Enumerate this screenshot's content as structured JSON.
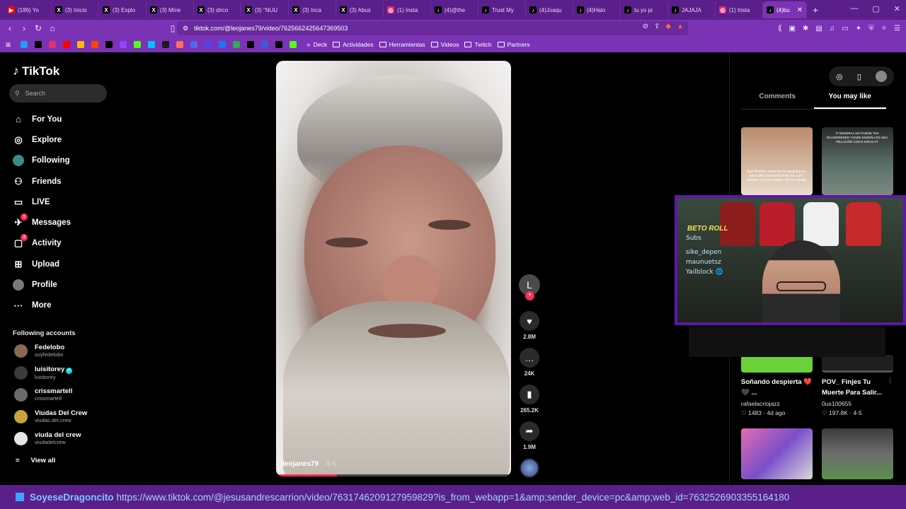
{
  "browser": {
    "tabs": [
      {
        "label": "(186) Yo",
        "icon": "youtube-icon",
        "color": "#ff0000",
        "glyph": "▶"
      },
      {
        "label": "(3) Inicio",
        "icon": "x-icon",
        "color": "#000000",
        "glyph": "X"
      },
      {
        "label": "(3) Explo",
        "icon": "x-icon",
        "color": "#000000",
        "glyph": "X"
      },
      {
        "label": "(3) Mine",
        "icon": "x-icon",
        "color": "#000000",
        "glyph": "X"
      },
      {
        "label": "(3) dirco",
        "icon": "x-icon",
        "color": "#000000",
        "glyph": "X"
      },
      {
        "label": "(3) \"NUU",
        "icon": "x-icon",
        "color": "#000000",
        "glyph": "X"
      },
      {
        "label": "(3) Inca",
        "icon": "x-icon",
        "color": "#000000",
        "glyph": "X"
      },
      {
        "label": "(3) Abus",
        "icon": "x-icon",
        "color": "#000000",
        "glyph": "X"
      },
      {
        "label": "(1) Insta",
        "icon": "instagram-icon",
        "color": "#e1306c",
        "glyph": "◎"
      },
      {
        "label": "(4)@the",
        "icon": "tiktok-icon",
        "color": "#000000",
        "glyph": "♪"
      },
      {
        "label": "Trust My",
        "icon": "tiktok-icon",
        "color": "#000000",
        "glyph": "♪"
      },
      {
        "label": "(4)Joaqu",
        "icon": "tiktok-icon",
        "color": "#000000",
        "glyph": "♪"
      },
      {
        "label": "(4)Halo",
        "icon": "tiktok-icon",
        "color": "#000000",
        "glyph": "♪"
      },
      {
        "label": "tu yo pi",
        "icon": "tiktok-icon",
        "color": "#000000",
        "glyph": "♪"
      },
      {
        "label": "JAJAJA",
        "icon": "tiktok-icon",
        "color": "#000000",
        "glyph": "♪"
      },
      {
        "label": "(1) Insta",
        "icon": "instagram-icon",
        "color": "#e1306c",
        "glyph": "◎"
      },
      {
        "label": "(4)bu",
        "icon": "tiktok-icon",
        "color": "#000000",
        "glyph": "♪",
        "active": true
      }
    ],
    "url": "tiktok.com/@leojanes79/video/7625662425647369503",
    "bookmarks": [
      {
        "label": "Deck",
        "type": "link"
      },
      {
        "label": "Actividades",
        "type": "folder"
      },
      {
        "label": "Herramientas",
        "type": "folder"
      },
      {
        "label": "Videos",
        "type": "folder"
      },
      {
        "label": "Twitch",
        "type": "folder"
      },
      {
        "label": "Partners",
        "type": "folder"
      }
    ],
    "bookmark_icon_colors": [
      "#1da1f2",
      "#000000",
      "#e1306c",
      "#ff0000",
      "#fbbc05",
      "#ff4500",
      "#000000",
      "#9146ff",
      "#53fc18",
      "#00c2ff",
      "#1c1c1c",
      "#ff6f61",
      "#5865f2",
      "#4f46e5",
      "#1877f2",
      "#34a853",
      "#000000",
      "#3b5bdb",
      "#000000",
      "#53fc18"
    ]
  },
  "tiktok": {
    "logo": "TikTok",
    "search_placeholder": "Search",
    "nav": [
      {
        "label": "For You",
        "icon": "home-icon",
        "glyph": "⌂"
      },
      {
        "label": "Explore",
        "icon": "compass-icon",
        "glyph": "◎"
      },
      {
        "label": "Following",
        "icon": "following-avatar-icon",
        "glyph": "●"
      },
      {
        "label": "Friends",
        "icon": "friends-icon",
        "glyph": "⚇"
      },
      {
        "label": "LIVE",
        "icon": "live-icon",
        "glyph": "▭"
      },
      {
        "label": "Messages",
        "icon": "messages-icon",
        "glyph": "✈",
        "badge": "1"
      },
      {
        "label": "Activity",
        "icon": "activity-icon",
        "glyph": "▢",
        "badge": "3"
      },
      {
        "label": "Upload",
        "icon": "upload-icon",
        "glyph": "⊞"
      },
      {
        "label": "Profile",
        "icon": "profile-avatar-icon",
        "glyph": "●"
      },
      {
        "label": "More",
        "icon": "more-icon",
        "glyph": "···"
      }
    ],
    "following_title": "Following accounts",
    "following": [
      {
        "name": "Fedelobo",
        "handle": "soyfedelobo",
        "color": "#8a6a55"
      },
      {
        "name": "luisitorey",
        "handle": "luisitorey",
        "color": "#3b3b3b",
        "verified": true
      },
      {
        "name": "crissmartell",
        "handle": "crissmartell",
        "color": "#6b6b6b"
      },
      {
        "name": "Viudas Del Crew",
        "handle": "viudas.del.crew",
        "color": "#c9a23a"
      },
      {
        "name": "viuda del crew",
        "handle": "viudadelcrew",
        "color": "#e5e5e5"
      }
    ],
    "view_all": "View all",
    "video": {
      "author": "leojanes79",
      "date": "· 4-6",
      "progress_fraction": 0.26
    },
    "actions": {
      "creator_initial": "L",
      "likes": "2.8M",
      "comments": "24K",
      "saves": "265.2K",
      "shares": "1.9M"
    },
    "right_tabs": {
      "comments": "Comments",
      "you_may_like": "You may like"
    },
    "cards": [
      {
        "title": "Soñando despierta ❤️ 🖤 ...",
        "user": "rafaelacriojazz",
        "stats": "♡ 1483 · 4d ago"
      },
      {
        "title": "POV_ Finjes Tu Muerte Para Salir...",
        "user": "0us100655",
        "stats": "♡ 197.8K · 4-5"
      }
    ],
    "card1_caption": "that Positive when you're laughing so hard with your friend that you can't breathe and you realize this is actually",
    "card2_caption": "IT GENERAL NO PUEDE TAN RAASERIENDO YANKE ENSEÑA EN UNA RELACIÓN CON 5 KIRAS AT"
  },
  "webcam": {
    "brand": "BETO ROLL",
    "lines": [
      "Subs",
      "sike_depen",
      "maunuetsz",
      "Yailblock 🌐"
    ]
  },
  "status": {
    "user": "SoyeseDragoncito",
    "url": "https://www.tiktok.com/@jesusandrescarrion/video/7631746209127959829?is_from_webapp=1&amp;sender_device=pc&amp;web_id=7632526903355164180"
  }
}
